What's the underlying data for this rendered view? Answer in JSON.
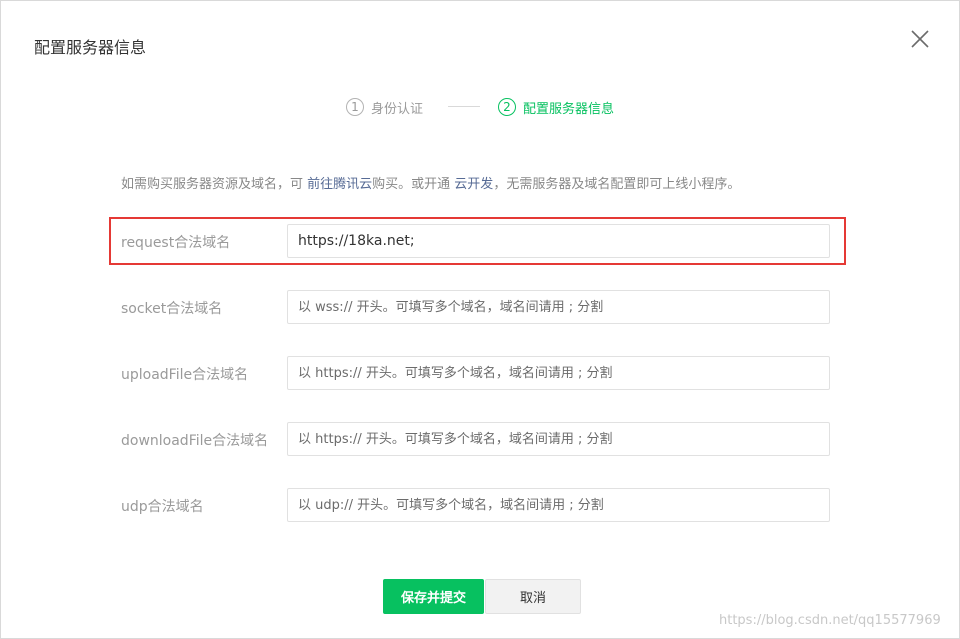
{
  "dialog": {
    "title": "配置服务器信息",
    "close_icon": "close-icon"
  },
  "steps": [
    {
      "num": "1",
      "label": "身份认证",
      "state": "done"
    },
    {
      "num": "2",
      "label": "配置服务器信息",
      "state": "active"
    }
  ],
  "tip": {
    "text_before": "如需购买服务器资源及域名，可 ",
    "link1": "前往腾讯云",
    "text_middle": "购买。或开通 ",
    "link2": "云开发",
    "text_after": "，无需服务器及域名配置即可上线小程序。"
  },
  "fields": {
    "request": {
      "label": "request合法域名",
      "value": "https://18ka.net;",
      "placeholder": ""
    },
    "socket": {
      "label": "socket合法域名",
      "value": "",
      "placeholder": "以 wss:// 开头。可填写多个域名，域名间请用 ; 分割"
    },
    "uploadFile": {
      "label": "uploadFile合法域名",
      "value": "",
      "placeholder": "以 https:// 开头。可填写多个域名，域名间请用 ; 分割"
    },
    "downloadFile": {
      "label": "downloadFile合法域名",
      "value": "",
      "placeholder": "以 https:// 开头。可填写多个域名，域名间请用 ; 分割"
    },
    "udp": {
      "label": "udp合法域名",
      "value": "",
      "placeholder": "以 udp:// 开头。可填写多个域名，域名间请用 ; 分割"
    }
  },
  "buttons": {
    "save": "保存并提交",
    "cancel": "取消"
  },
  "watermark": "https://blog.csdn.net/qq15577969",
  "colors": {
    "accent": "#07c160",
    "link": "#576b95",
    "highlight": "#e53935"
  }
}
